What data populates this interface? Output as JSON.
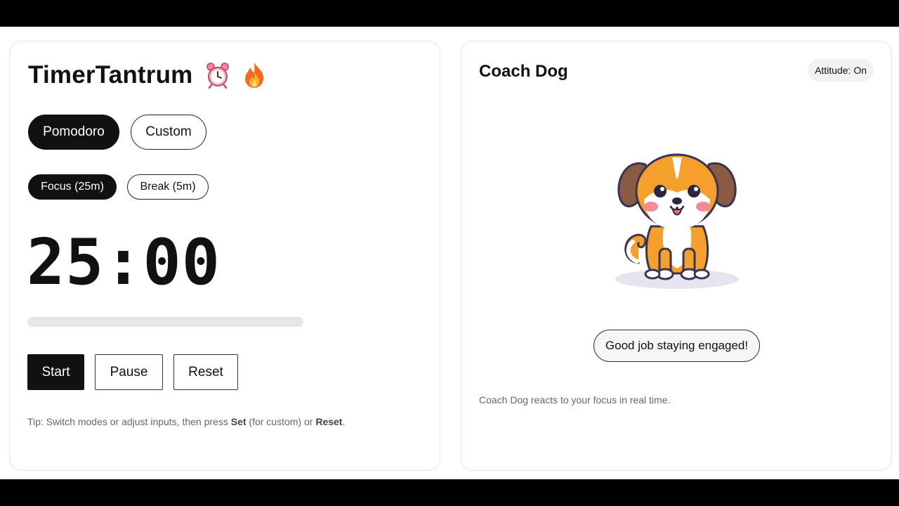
{
  "app": {
    "title": "TimerTantrum",
    "title_emojis": [
      "alarm-clock-icon",
      "fire-icon"
    ]
  },
  "modes": {
    "items": [
      {
        "label": "Pomodoro",
        "active": true
      },
      {
        "label": "Custom",
        "active": false
      }
    ]
  },
  "phases": {
    "items": [
      {
        "label": "Focus (25m)",
        "active": true
      },
      {
        "label": "Break (5m)",
        "active": false
      }
    ]
  },
  "timer": {
    "display": "25:00",
    "progress_fraction": 0
  },
  "controls": {
    "start_label": "Start",
    "pause_label": "Pause",
    "reset_label": "Reset"
  },
  "tip": {
    "prefix": "Tip: Switch modes or adjust inputs, then press ",
    "bold_set": "Set",
    "middle": " (for custom) or ",
    "bold_reset": "Reset",
    "suffix": "."
  },
  "coach": {
    "title": "Coach Dog",
    "attitude_badge": "Attitude: On",
    "speech": "Good job staying engaged!",
    "caption": "Coach Dog reacts to your focus in real time."
  },
  "colors": {
    "accent": "#111111",
    "track": "#e6e6e6",
    "dog_orange": "#f5a02c",
    "dog_ear": "#8a5a44"
  }
}
